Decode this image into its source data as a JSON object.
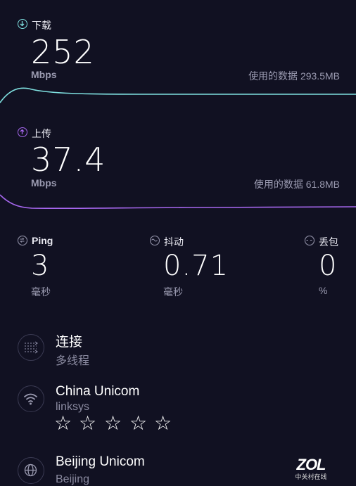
{
  "download": {
    "label": "下载",
    "value": "252",
    "unit": "Mbps",
    "data_used_label": "使用的数据",
    "data_used_value": "293.5MB",
    "line_color": "#7fe0e0"
  },
  "upload": {
    "label": "上传",
    "value": "37.4",
    "unit": "Mbps",
    "data_used_label": "使用的数据",
    "data_used_value": "61.8MB",
    "line_color": "#a667ee"
  },
  "stats": {
    "ping": {
      "label": "Ping",
      "value": "3",
      "unit": "毫秒"
    },
    "jitter": {
      "label": "抖动",
      "value": "0.71",
      "unit": "毫秒"
    },
    "loss": {
      "label": "丢包",
      "value": "0",
      "unit": "%"
    }
  },
  "connection": {
    "title": "连接",
    "subtitle": "多线程"
  },
  "isp": {
    "title": "China Unicom",
    "subtitle": "linksys",
    "rating_max": 5
  },
  "server": {
    "title": "Beijing Unicom",
    "subtitle": "Beijing"
  },
  "watermark": {
    "logo": "ZOL",
    "subtitle": "中关村在线"
  },
  "colors": {
    "background": "#111122",
    "download": "#7fe0e0",
    "upload": "#a667ee"
  }
}
